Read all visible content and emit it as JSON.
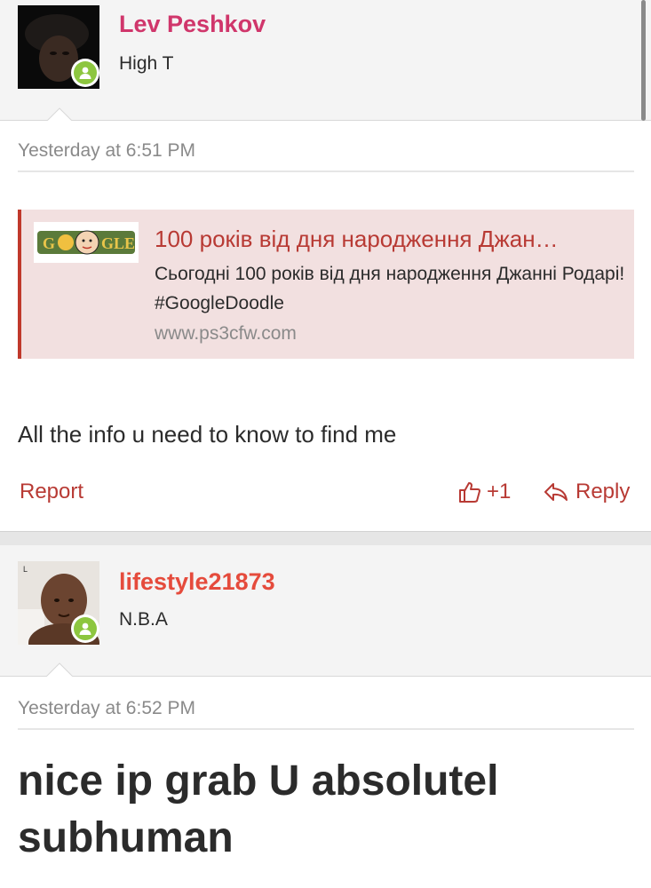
{
  "posts": [
    {
      "username": "Lev Peshkov",
      "user_title": "High T",
      "username_color": "#d0366b",
      "timestamp": "Yesterday at 6:51 PM",
      "link_card": {
        "title": "100 років від дня народження Джан…",
        "description": "Сьогодні 100 років від дня народження Джанні Родарі! #GoogleDoodle",
        "url": "www.ps3cfw.com",
        "thumbnail_text": "GOOGLE"
      },
      "message": "All the info u need to know to find me",
      "actions": {
        "report": "Report",
        "like_count": "+1",
        "reply": "Reply"
      }
    },
    {
      "username": "lifestyle21873",
      "user_title": "N.B.A",
      "username_color": "#e54b3c",
      "timestamp": "Yesterday at 6:52 PM",
      "message": "nice ip grab U absolutel subhuman"
    }
  ],
  "colors": {
    "accent": "#b83a34",
    "online": "#8dc63f",
    "header_bg": "#f4f4f4",
    "card_bg": "#f2e0e0"
  }
}
